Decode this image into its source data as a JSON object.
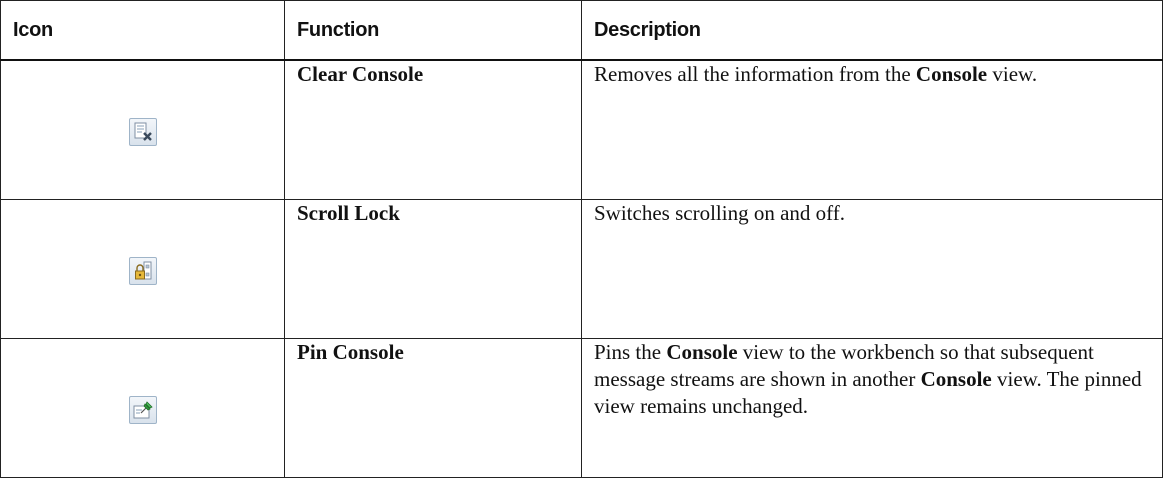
{
  "table": {
    "headers": {
      "icon": "Icon",
      "function": "Function",
      "description": "Description"
    },
    "rows": [
      {
        "icon": "clear-console-icon",
        "function": "Clear Console",
        "desc": {
          "before": "Removes all the information from the ",
          "bold": "Console",
          "after": " view."
        }
      },
      {
        "icon": "scroll-lock-icon",
        "function": "Scroll Lock",
        "desc": {
          "text": "Switches scrolling on and off."
        }
      },
      {
        "icon": "pin-console-icon",
        "function": "Pin Console",
        "desc": {
          "before": "Pins the ",
          "bold": "Console",
          "middle": " view to the workbench so that subsequent message streams are shown in another ",
          "bold2": "Console",
          "after": " view. The pinned view remains unchanged."
        }
      }
    ]
  }
}
